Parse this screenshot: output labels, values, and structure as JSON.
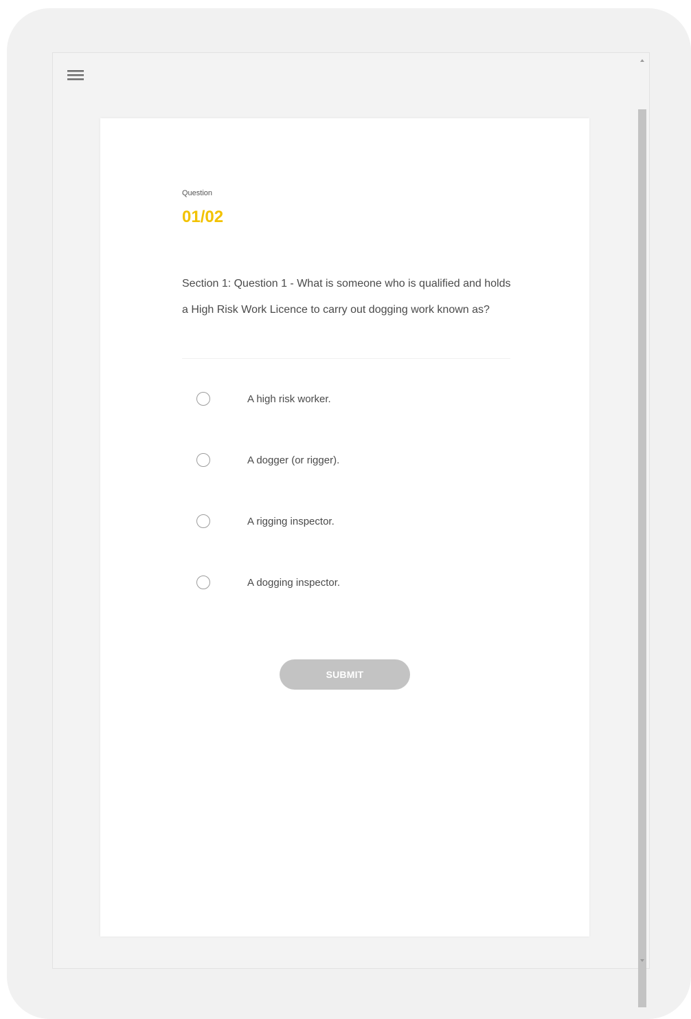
{
  "menu": {
    "icon": "hamburger-menu-icon"
  },
  "quiz": {
    "question_label": "Question",
    "counter": "01/02",
    "question_text": "Section 1: Question 1 - What is someone who is qualified and holds a High Risk Work Licence to carry out dogging work known as?",
    "options": [
      {
        "label": "A high risk worker."
      },
      {
        "label": "A dogger (or rigger)."
      },
      {
        "label": "A rigging inspector."
      },
      {
        "label": "A dogging inspector."
      }
    ],
    "submit_label": "SUBMIT"
  },
  "colors": {
    "accent": "#f2c200",
    "submit_disabled": "#c3c3c3",
    "text": "#4a4a4a"
  }
}
